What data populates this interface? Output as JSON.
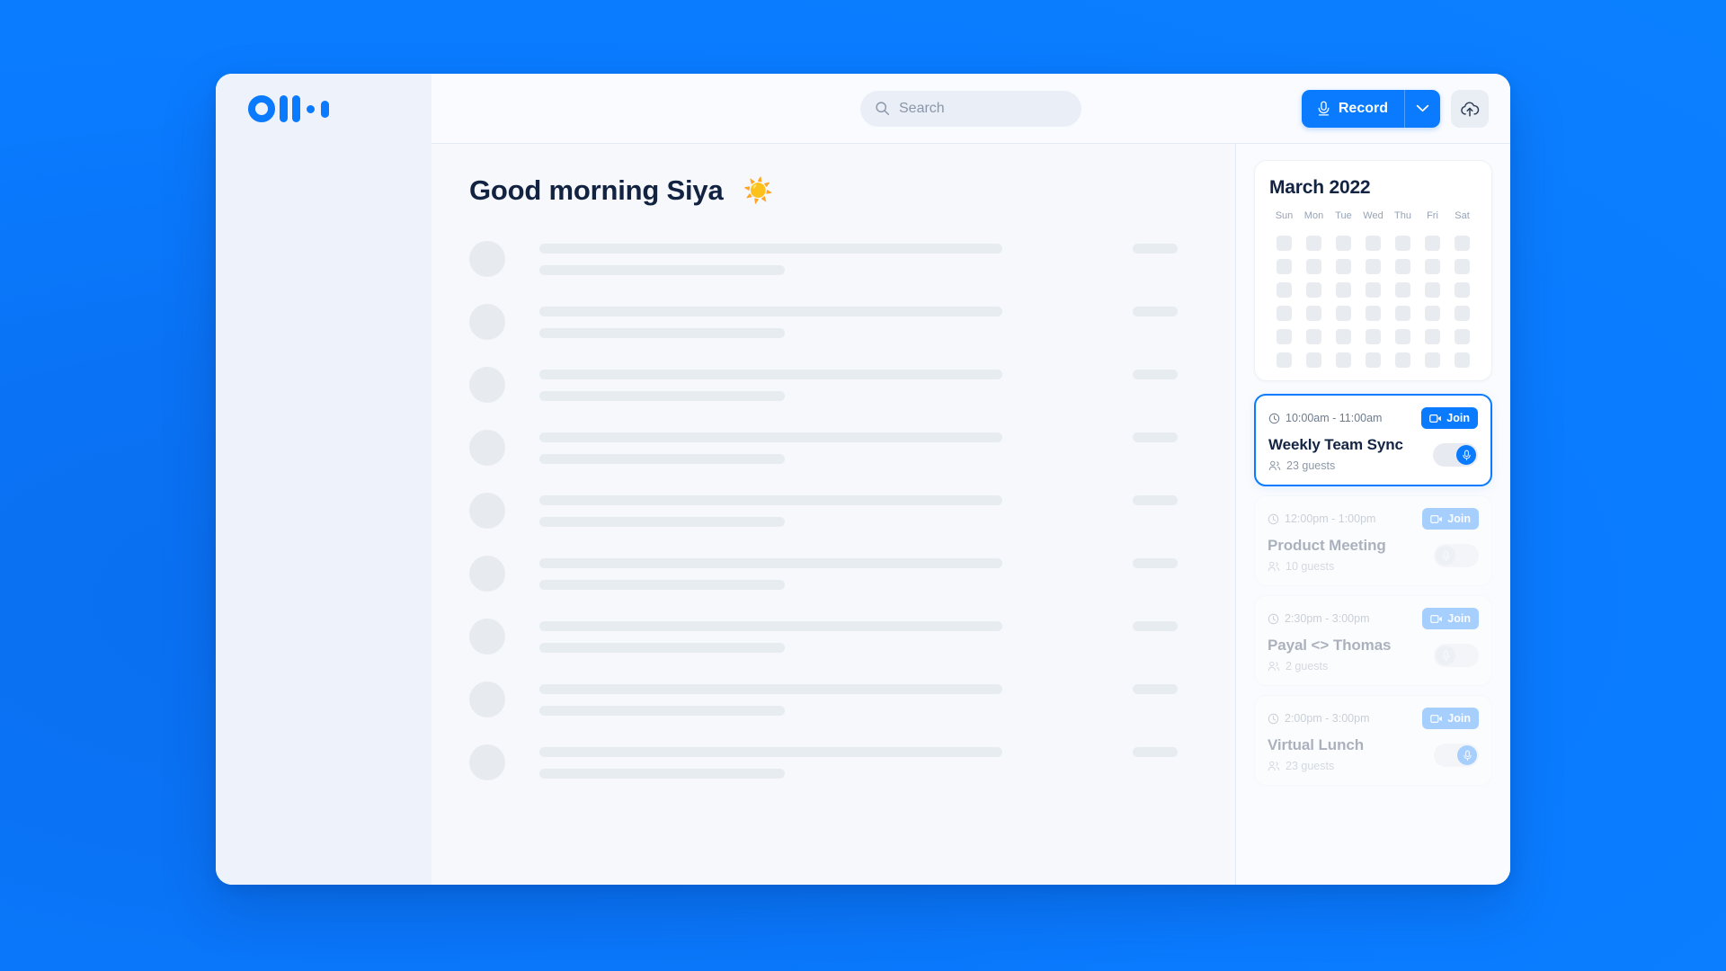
{
  "brand": {
    "logo_name": "otter-logo",
    "accent": "#0a7bff"
  },
  "header": {
    "search": {
      "placeholder": "Search",
      "value": ""
    },
    "record_label": "Record",
    "record_caret_name": "chevron-down-icon",
    "upload_name": "cloud-upload-icon"
  },
  "main": {
    "greeting": "Good morning Siya",
    "greeting_emoji": "☀️",
    "skeleton_rows": 9
  },
  "rail": {
    "calendar": {
      "title": "March 2022",
      "dow": [
        "Sun",
        "Mon",
        "Tue",
        "Wed",
        "Thu",
        "Fri",
        "Sat"
      ],
      "weeks": 6,
      "days_per_week": 7
    },
    "meetings": [
      {
        "time": "10:00am  - 11:00am",
        "title": "Weekly Team Sync",
        "guests": "23 guests",
        "join_label": "Join",
        "state": "active",
        "toggle": "on"
      },
      {
        "time": "12:00pm - 1:00pm",
        "title": "Product Meeting",
        "guests": "10 guests",
        "join_label": "Join",
        "state": "dim",
        "toggle": "off"
      },
      {
        "time": "2:30pm - 3:00pm",
        "title": "Payal <> Thomas",
        "guests": "2 guests",
        "join_label": "Join",
        "state": "dim",
        "toggle": "off"
      },
      {
        "time": "2:00pm - 3:00pm",
        "title": "Virtual Lunch",
        "guests": "23 guests",
        "join_label": "Join",
        "state": "dim",
        "toggle": "on"
      }
    ]
  }
}
